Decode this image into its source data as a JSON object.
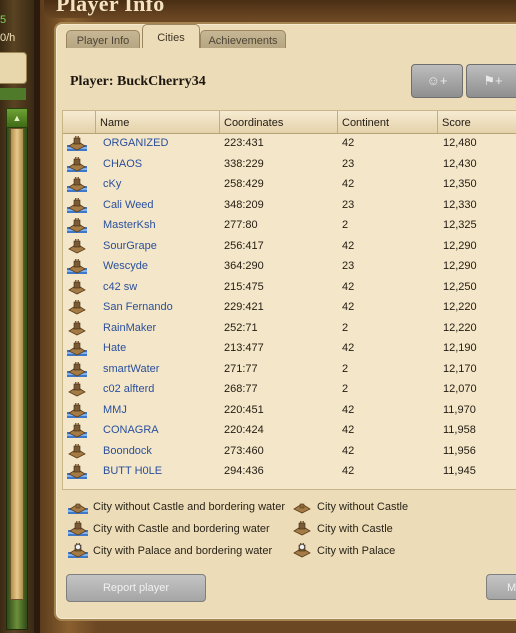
{
  "window": {
    "title": "Player Info"
  },
  "side": {
    "top_value": "5",
    "rate": "0/h",
    "scroll_up": "▲"
  },
  "tabs": [
    {
      "label": "Player Info",
      "active": false
    },
    {
      "label": "Cities",
      "active": true
    },
    {
      "label": "Achievements",
      "active": false
    }
  ],
  "player": {
    "label": "Player:",
    "name": "BuckCherry34"
  },
  "top_buttons": [
    {
      "icon": "add-friend-icon",
      "label": "☺+"
    },
    {
      "icon": "add-flag-icon",
      "label": "⚑+"
    }
  ],
  "table": {
    "headers": [
      "Name",
      "Coordinates",
      "Continent",
      "Score"
    ],
    "rows": [
      {
        "icon": "city-castle-water-icon",
        "name": "ORGANIZED",
        "coords": "223:431",
        "continent": "42",
        "score": "12,480"
      },
      {
        "icon": "city-castle-water-icon",
        "name": "CHAOS",
        "coords": "338:229",
        "continent": "23",
        "score": "12,430"
      },
      {
        "icon": "city-castle-water-icon",
        "name": "cKy",
        "coords": "258:429",
        "continent": "42",
        "score": "12,350"
      },
      {
        "icon": "city-castle-water-icon",
        "name": "Cali Weed",
        "coords": "348:209",
        "continent": "23",
        "score": "12,330"
      },
      {
        "icon": "city-castle-water-icon",
        "name": "MasterKsh",
        "coords": "277:80",
        "continent": "2",
        "score": "12,325"
      },
      {
        "icon": "city-castle-icon",
        "name": "SourGrape",
        "coords": "256:417",
        "continent": "42",
        "score": "12,290"
      },
      {
        "icon": "city-castle-water-icon",
        "name": "Wescyde",
        "coords": "364:290",
        "continent": "23",
        "score": "12,290"
      },
      {
        "icon": "city-castle-icon",
        "name": "c42 sw",
        "coords": "215:475",
        "continent": "42",
        "score": "12,250"
      },
      {
        "icon": "city-castle-icon",
        "name": "San Fernando",
        "coords": "229:421",
        "continent": "42",
        "score": "12,220"
      },
      {
        "icon": "city-castle-icon",
        "name": "RainMaker",
        "coords": "252:71",
        "continent": "2",
        "score": "12,220"
      },
      {
        "icon": "city-castle-water-icon",
        "name": "Hate",
        "coords": "213:477",
        "continent": "42",
        "score": "12,190"
      },
      {
        "icon": "city-castle-water-icon",
        "name": "smartWater",
        "coords": "271:77",
        "continent": "2",
        "score": "12,170"
      },
      {
        "icon": "city-castle-icon",
        "name": "c02 alfterd",
        "coords": "268:77",
        "continent": "2",
        "score": "12,070"
      },
      {
        "icon": "city-castle-water-icon",
        "name": "MMJ",
        "coords": "220:451",
        "continent": "42",
        "score": "11,970"
      },
      {
        "icon": "city-castle-water-icon",
        "name": "CONAGRA",
        "coords": "220:424",
        "continent": "42",
        "score": "11,958"
      },
      {
        "icon": "city-castle-icon",
        "name": "Boondock",
        "coords": "273:460",
        "continent": "42",
        "score": "11,956"
      },
      {
        "icon": "city-castle-water-icon",
        "name": "BUTT H0LE",
        "coords": "294:436",
        "continent": "42",
        "score": "11,945"
      }
    ]
  },
  "legend": [
    {
      "icon": "city-water-icon",
      "label": "City without Castle and bordering water"
    },
    {
      "icon": "city-icon",
      "label": "City without Castle"
    },
    {
      "icon": "city-castle-water-icon",
      "label": "City with Castle and bordering water"
    },
    {
      "icon": "city-castle-icon",
      "label": "City with Castle"
    },
    {
      "icon": "city-palace-water-icon",
      "label": "City with Palace and bordering water"
    },
    {
      "icon": "city-palace-icon",
      "label": "City with Palace"
    }
  ],
  "buttons": {
    "report": "Report player",
    "more": "M"
  },
  "colors": {
    "link": "#2a4f9d",
    "parchment": "#ecdcb8"
  }
}
